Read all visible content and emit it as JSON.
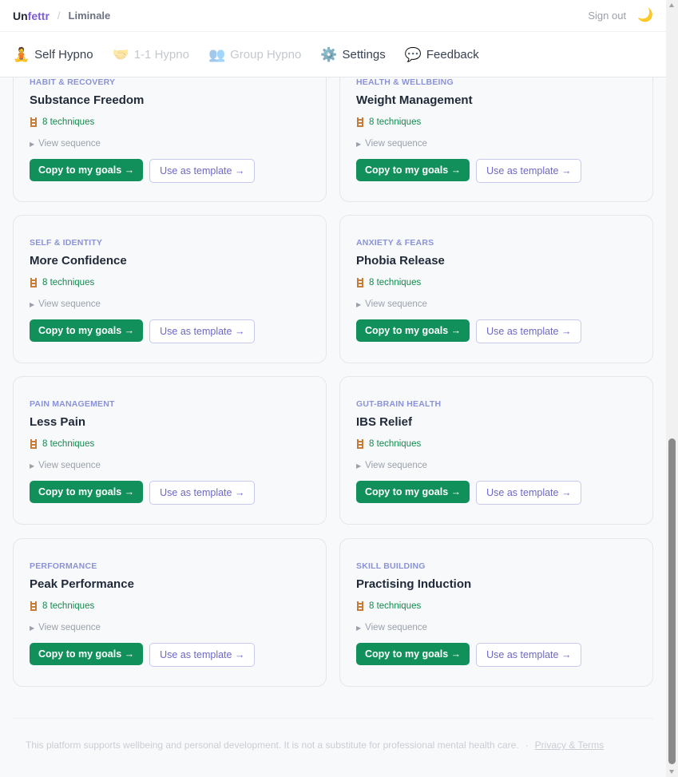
{
  "topbar": {
    "brand_prefix": "Un",
    "brand_suffix": "fettr",
    "separator": "/",
    "breadcrumb": "Liminale",
    "signout_label": "Sign out",
    "theme_icon": "moon-icon"
  },
  "nav": [
    {
      "icon": "🧘",
      "label": "Self Hypno",
      "enabled": true
    },
    {
      "icon": "🤝",
      "label": "1-1 Hypno",
      "enabled": false
    },
    {
      "icon": "👥",
      "label": "Group Hypno",
      "enabled": false
    },
    {
      "icon": "⚙️",
      "label": "Settings",
      "enabled": true
    },
    {
      "icon": "💬",
      "label": "Feedback",
      "enabled": true
    }
  ],
  "cards": [
    {
      "category": "Habit & Recovery",
      "title": "Substance Freedom",
      "techniques": "8 techniques",
      "sequence_label": "View sequence",
      "copy_label": "Copy to my goals →",
      "template_label": "Use as template →"
    },
    {
      "category": "Health & Wellbeing",
      "title": "Weight Management",
      "techniques": "8 techniques",
      "sequence_label": "View sequence",
      "copy_label": "Copy to my goals →",
      "template_label": "Use as template →"
    },
    {
      "category": "Self & Identity",
      "title": "More Confidence",
      "techniques": "8 techniques",
      "sequence_label": "View sequence",
      "copy_label": "Copy to my goals →",
      "template_label": "Use as template →"
    },
    {
      "category": "Anxiety & Fears",
      "title": "Phobia Release",
      "techniques": "8 techniques",
      "sequence_label": "View sequence",
      "copy_label": "Copy to my goals →",
      "template_label": "Use as template →"
    },
    {
      "category": "Pain Management",
      "title": "Less Pain",
      "techniques": "8 techniques",
      "sequence_label": "View sequence",
      "copy_label": "Copy to my goals →",
      "template_label": "Use as template →"
    },
    {
      "category": "Gut-Brain Health",
      "title": "IBS Relief",
      "techniques": "8 techniques",
      "sequence_label": "View sequence",
      "copy_label": "Copy to my goals →",
      "template_label": "Use as template →"
    },
    {
      "category": "Performance",
      "title": "Peak Performance",
      "techniques": "8 techniques",
      "sequence_label": "View sequence",
      "copy_label": "Copy to my goals →",
      "template_label": "Use as template →"
    },
    {
      "category": "Skill Building",
      "title": "Practising Induction",
      "techniques": "8 techniques",
      "sequence_label": "View sequence",
      "copy_label": "Copy to my goals →",
      "template_label": "Use as template →"
    }
  ],
  "footer": {
    "disclaimer": "This platform supports wellbeing and personal development. It is not a substitute for professional mental health care.",
    "separator": "·",
    "link_label": "Privacy & Terms"
  },
  "colors": {
    "brand_accent": "#7c5cd6",
    "primary_button": "#12905c",
    "category_label": "#8b93d8",
    "technique_text": "#138a4e"
  }
}
